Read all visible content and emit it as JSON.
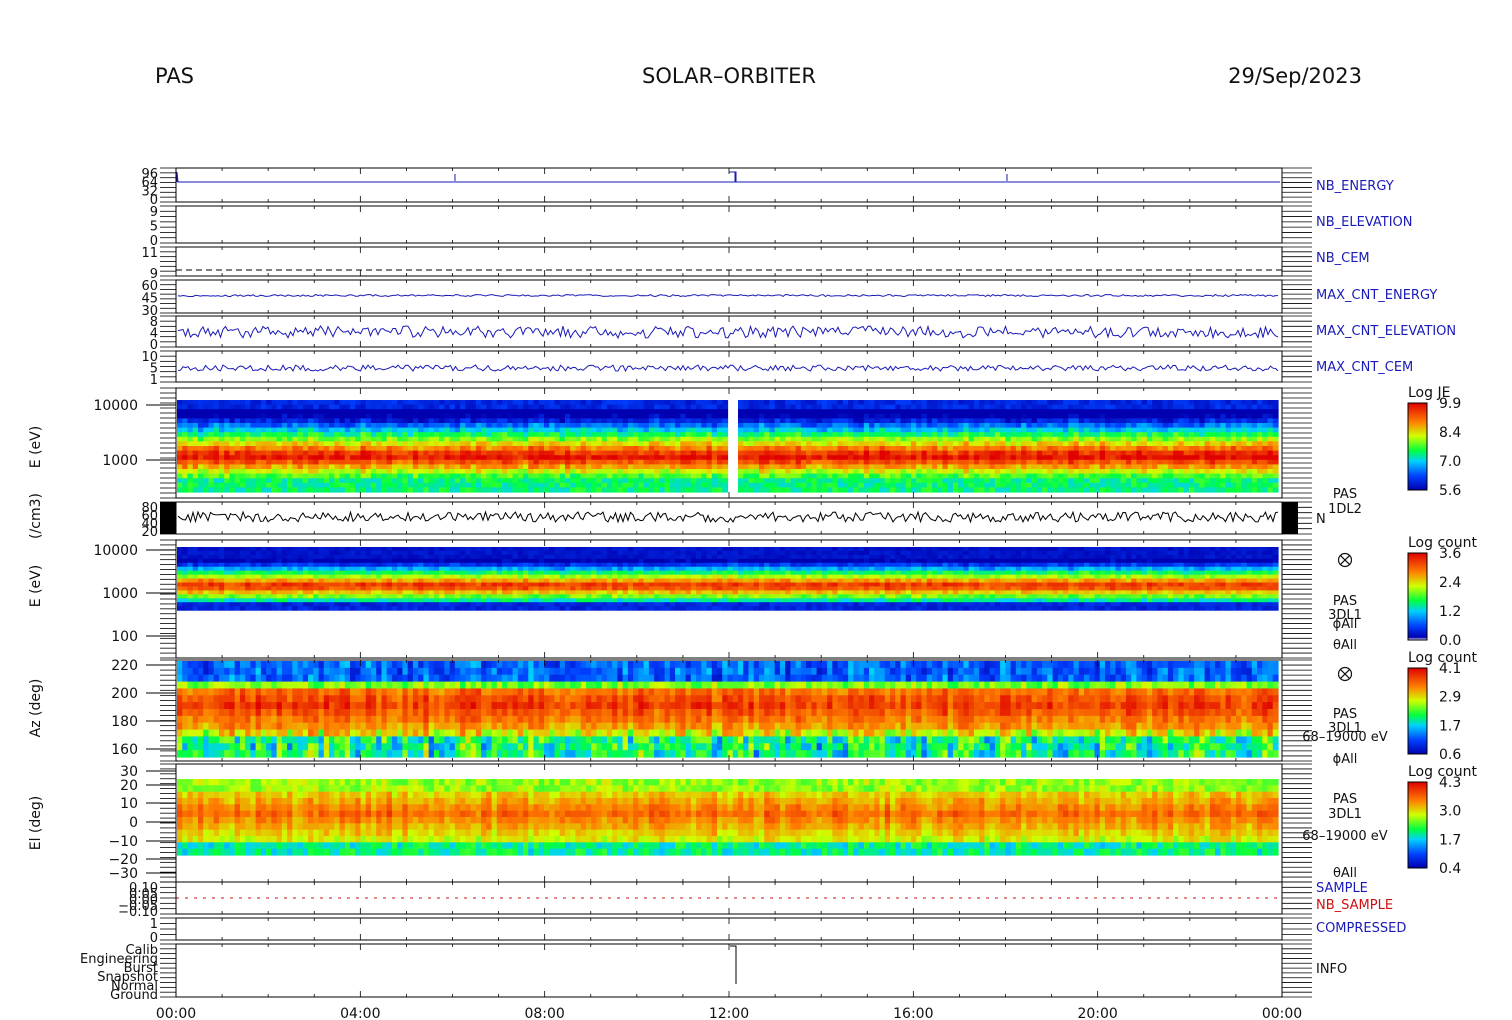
{
  "header": {
    "left": "PAS",
    "center": "SOLAR–ORBITER",
    "right": "29/Sep/2023"
  },
  "colors": {
    "trace_blue": "#1a1ab8",
    "trace_black": "#000000",
    "trace_red": "#d01010"
  },
  "chart_data": {
    "type": "heatmap",
    "x_ticks": [
      "00:00",
      "04:00",
      "08:00",
      "12:00",
      "16:00",
      "20:00",
      "00:00"
    ],
    "panels": [
      {
        "id": "nb_energy",
        "type": "line",
        "label": "NB_ENERGY",
        "ticks": [
          "96",
          "64",
          "32",
          "0"
        ],
        "values": [
          96,
          32,
          32,
          32,
          32,
          32,
          32,
          32,
          32,
          32,
          32,
          32,
          32,
          32,
          32,
          32,
          32,
          32,
          32,
          32,
          32,
          32,
          32,
          32,
          32,
          32,
          32,
          32,
          32,
          32,
          32,
          32,
          32,
          32,
          32,
          32,
          32,
          32,
          32,
          32,
          32,
          32,
          32,
          32,
          32,
          32,
          32,
          32,
          32,
          32,
          32,
          32,
          32,
          32,
          32,
          32,
          32,
          32,
          32,
          32,
          32,
          32,
          32,
          32,
          32,
          32,
          32,
          32,
          32,
          32,
          32,
          32,
          32,
          32,
          32,
          32,
          32,
          32,
          32,
          32,
          32,
          32,
          32,
          32,
          32,
          32,
          32,
          32,
          32,
          32,
          32,
          32,
          32,
          32,
          32,
          32,
          32,
          32,
          32,
          32,
          32,
          32,
          32,
          32,
          32,
          32,
          32,
          32,
          32,
          32,
          32,
          32,
          32,
          32,
          32,
          32,
          32,
          32,
          32,
          32,
          32,
          32,
          32,
          32,
          32,
          32,
          32,
          32,
          32,
          32,
          32,
          32,
          32,
          32,
          32,
          32,
          32,
          32,
          32,
          32,
          32,
          32,
          32,
          32,
          32,
          32,
          32,
          32,
          32,
          32,
          32,
          32,
          32,
          32,
          32,
          32,
          32,
          32,
          32,
          32,
          32,
          32,
          32,
          32,
          32,
          32,
          32,
          32,
          32,
          32,
          32,
          32,
          32,
          32,
          32,
          32,
          32,
          32,
          32,
          32,
          32,
          32,
          32,
          32,
          32,
          32,
          32,
          32,
          32,
          32,
          32,
          32,
          32,
          32,
          32,
          32,
          32,
          32,
          32,
          32
        ]
      },
      {
        "id": "nb_elevation",
        "type": "line",
        "label": "NB_ELEVATION",
        "ticks": [
          "9",
          "5",
          "0"
        ],
        "values": []
      },
      {
        "id": "nb_cem",
        "type": "line",
        "label": "NB_CEM",
        "ticks": [
          "11",
          "9"
        ],
        "values": []
      },
      {
        "id": "max_cnt_energy",
        "type": "line",
        "label": "MAX_CNT_ENERGY",
        "ticks": [
          "60",
          "45",
          "30"
        ],
        "values": []
      },
      {
        "id": "max_cnt_elevation",
        "type": "line",
        "label": "MAX_CNT_ELEVATION",
        "ticks": [
          "8",
          "4",
          "0"
        ],
        "values": []
      },
      {
        "id": "max_cnt_cem",
        "type": "line",
        "label": "MAX_CNT_CEM",
        "ticks": [
          "10",
          "5",
          "1"
        ],
        "values": []
      },
      {
        "id": "energy_1dl2",
        "type": "heatmap",
        "ylabel": "E (eV)",
        "yticks": [
          "10000",
          "1000"
        ],
        "colorbar": {
          "title": "Log JE",
          "ticks": [
            "9.9",
            "8.4",
            "7.0",
            "5.6"
          ]
        }
      },
      {
        "id": "density",
        "type": "line",
        "ylabel": "(/cm3)",
        "ticks": [
          "80",
          "60",
          "40",
          "20"
        ],
        "legend": [
          "PAS",
          "1DL2",
          "N"
        ]
      },
      {
        "id": "energy_3dl1",
        "type": "heatmap",
        "ylabel": "E (eV)",
        "yticks": [
          "10000",
          "1000",
          "100"
        ],
        "labels": [
          "PAS",
          "3DL1",
          "ϕAll",
          "θAll"
        ],
        "colorbar": {
          "title": "Log count",
          "ticks": [
            "3.6",
            "2.4",
            "1.2",
            "0.0"
          ]
        }
      },
      {
        "id": "azimuth",
        "type": "heatmap",
        "ylabel": "Az (deg)",
        "yticks": [
          "220",
          "200",
          "180",
          "160"
        ],
        "labels": [
          "PAS",
          "3DL1",
          "68–19000 eV",
          "ϕAll"
        ],
        "colorbar": {
          "title": "Log count",
          "ticks": [
            "4.1",
            "2.9",
            "1.7",
            "0.6"
          ]
        }
      },
      {
        "id": "elevation",
        "type": "heatmap",
        "ylabel": "El (deg)",
        "yticks": [
          "30",
          "20",
          "10",
          "0",
          "−10",
          "−20",
          "−30"
        ],
        "labels": [
          "PAS",
          "3DL1",
          "68–19000 eV",
          "θAll"
        ],
        "colorbar": {
          "title": "Log count",
          "ticks": [
            "4.3",
            "3.0",
            "1.7",
            "0.4"
          ]
        }
      },
      {
        "id": "sample",
        "type": "line",
        "ticks": [
          "0.10",
          "0.05",
          "0.00",
          "−0.05",
          "−0.10"
        ],
        "legend": [
          "SAMPLE",
          "NB_SAMPLE"
        ]
      },
      {
        "id": "compressed",
        "type": "line",
        "label": "COMPRESSED",
        "ticks": [
          "1",
          "0"
        ]
      },
      {
        "id": "info",
        "type": "line",
        "label": "INFO",
        "ticks": [
          "Calib",
          "Engineering",
          "Burst",
          "Snapshot",
          "Normal",
          "Ground"
        ]
      }
    ]
  }
}
